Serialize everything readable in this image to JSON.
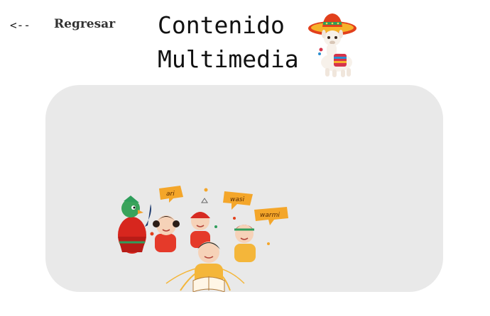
{
  "nav": {
    "back_arrow": "<--",
    "back_label": "Regresar"
  },
  "header": {
    "title_line1": "Contenido",
    "title_line2": "Multimedia"
  },
  "media": {
    "words": [
      "ari",
      "wasi",
      "warmi"
    ]
  },
  "colors": {
    "card_background": "#e9e9e9",
    "bubble": "#f4a62a"
  }
}
